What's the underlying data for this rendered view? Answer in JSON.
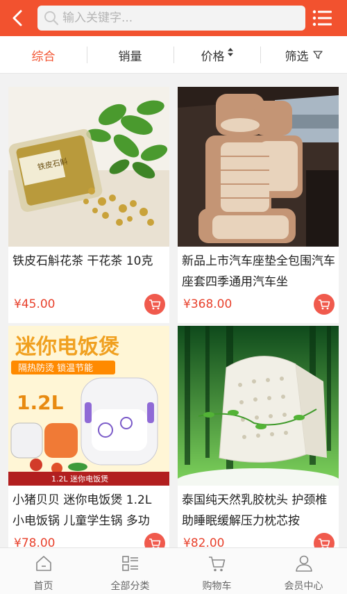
{
  "header": {
    "search_placeholder": "输入关键字..."
  },
  "sortbar": {
    "items": [
      {
        "label": "综合"
      },
      {
        "label": "销量"
      },
      {
        "label": "价格"
      },
      {
        "label": "筛选"
      }
    ]
  },
  "products": [
    {
      "title": "铁皮石斛花茶 干花茶 10克",
      "price": "¥45.00",
      "image": "dried-flower-tea-jar"
    },
    {
      "title": "新品上市汽车座垫全包围汽车座套四季通用汽车坐",
      "price": "¥368.00",
      "image": "car-seat-covers"
    },
    {
      "title": "小猪贝贝 迷你电饭煲 1.2L 小电饭锅 儿童学生锅 多功",
      "price": "¥78.00",
      "image": "mini-rice-cooker"
    },
    {
      "title": "泰国纯天然乳胶枕头 护颈椎助睡眠缓解压力枕芯按",
      "price": "¥82.00",
      "image": "latex-pillow"
    }
  ],
  "image_text": {
    "rice_cooker_banner": "迷你电饭煲",
    "rice_cooker_slogan": "隔热防烫 锁温节能",
    "rice_cooker_volume": "1.2L",
    "rice_cooker_caption": "1.2L 迷你电饭煲",
    "tea_jar_label": "铁皮石斛"
  },
  "bottomnav": {
    "items": [
      {
        "label": "首页",
        "icon": "home-icon"
      },
      {
        "label": "全部分类",
        "icon": "category-icon"
      },
      {
        "label": "购物车",
        "icon": "cart-icon"
      },
      {
        "label": "会员中心",
        "icon": "user-icon"
      }
    ]
  },
  "colors": {
    "accent": "#f2522f",
    "price": "#e8412c"
  }
}
